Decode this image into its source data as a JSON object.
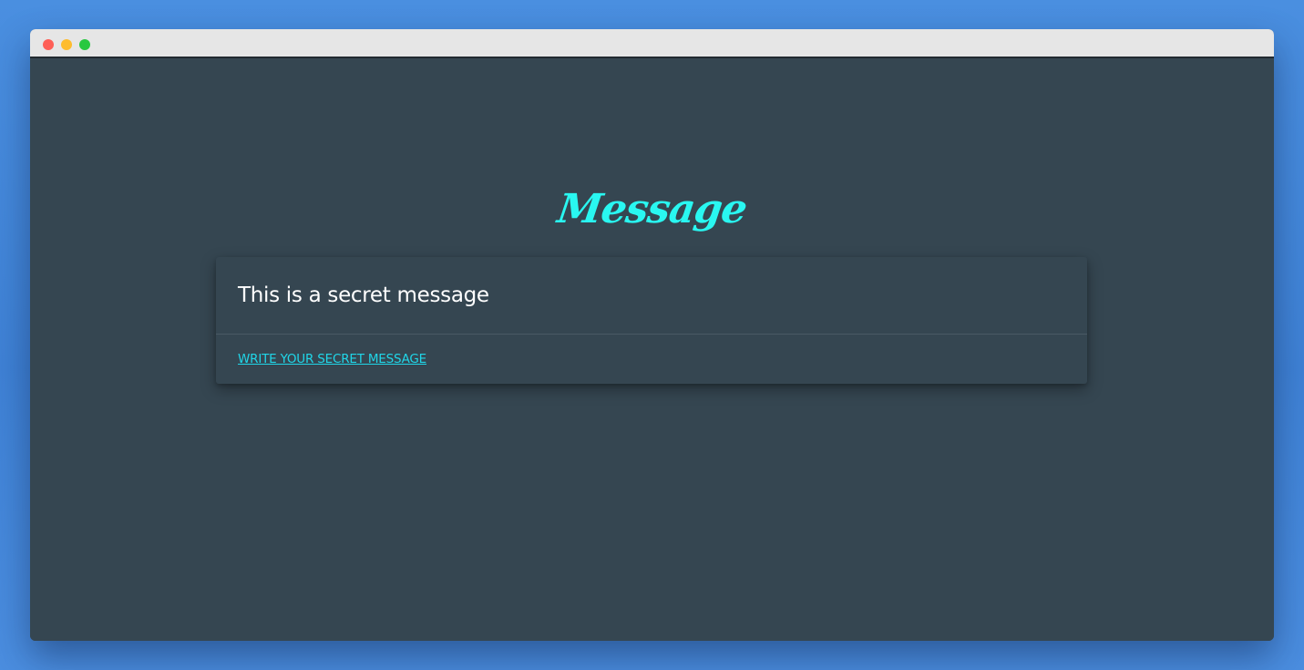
{
  "window": {
    "traffic_lights": [
      {
        "name": "close",
        "color": "#fe5f57"
      },
      {
        "name": "minimize",
        "color": "#febc2e"
      },
      {
        "name": "maximize",
        "color": "#28c840"
      }
    ]
  },
  "page": {
    "heading": "Message",
    "heading_color": "#29f7f1",
    "background_color": "#354651"
  },
  "card": {
    "message": "This is a secret message",
    "action_label": "WRITE YOUR SECRET MESSAGE",
    "action_color": "#20d6e8"
  }
}
